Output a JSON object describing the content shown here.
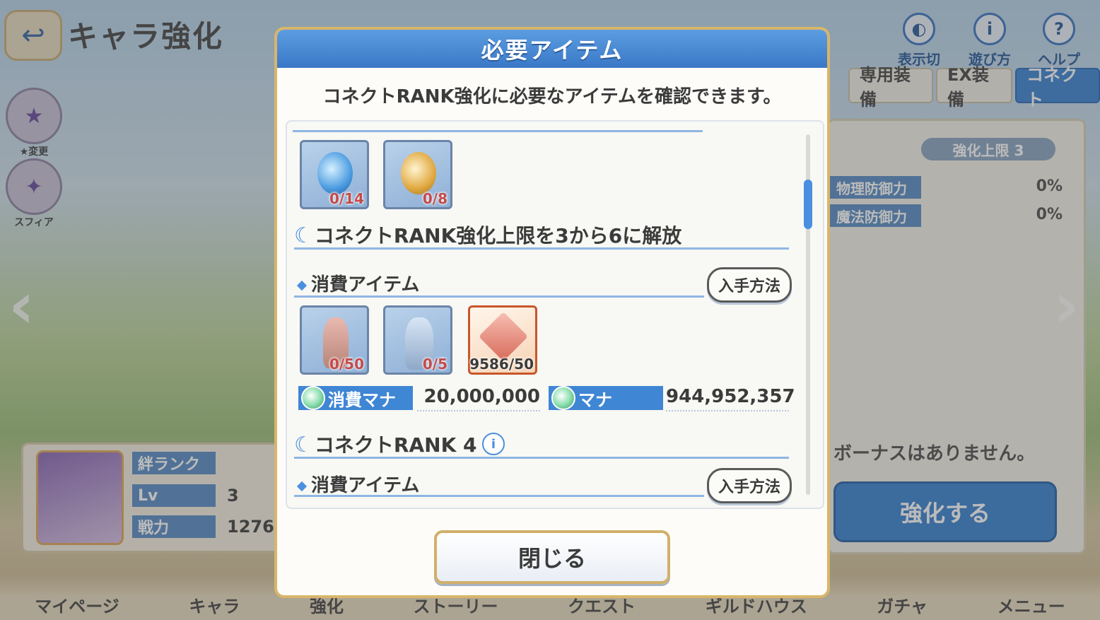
{
  "background": {
    "page_title": "キャラ強化",
    "top_icons": [
      {
        "label": "表示切替",
        "icon": "display-switch-icon"
      },
      {
        "label": "遊び方",
        "icon": "info-icon"
      },
      {
        "label": "ヘルプ",
        "icon": "help-icon"
      }
    ],
    "tabs": [
      "専用装備",
      "EX装備",
      "コネクト"
    ],
    "active_tab": "コネクト",
    "rank_pill": "強化上限 3",
    "stats": [
      {
        "label": "物理防御力",
        "value": "0%"
      },
      {
        "label": "魔法防御力",
        "value": "0%"
      }
    ],
    "bonus_text": "ボーナスはありません。",
    "enhance_button": "強化する",
    "card": {
      "rows": [
        {
          "label": "絆ランク",
          "value": ""
        },
        {
          "label": "Lv",
          "value": "3"
        },
        {
          "label": "戦力",
          "value": "1276"
        }
      ]
    },
    "side_icons": [
      {
        "label": "★変更"
      },
      {
        "label": "スフィア"
      }
    ],
    "bottom_nav": [
      "マイページ",
      "キャラ",
      "強化",
      "ストーリー",
      "クエスト",
      "ギルドハウス",
      "ガチャ",
      "メニュー"
    ]
  },
  "modal": {
    "title": "必要アイテム",
    "description": "コネクトRANK強化に必要なアイテムを確認できます。",
    "top_items": [
      {
        "count": "0/14",
        "color": "#4a9be0"
      },
      {
        "count": "0/8",
        "color": "#e0a840"
      }
    ],
    "section1": {
      "title": "コネクトRANK強化上限を3から6に解放",
      "consume_label": "消費アイテム",
      "get_method_label": "入手方法",
      "items": [
        {
          "count": "0/50",
          "kind": "statue"
        },
        {
          "count": "0/5",
          "kind": "statue"
        },
        {
          "count": "9586/50",
          "kind": "crystal"
        }
      ],
      "mana_cost_label": "消費マナ",
      "mana_cost_value": "20,000,000",
      "mana_label": "マナ",
      "mana_value": "944,952,357"
    },
    "section2": {
      "title": "コネクトRANK 4",
      "consume_label": "消費アイテム",
      "get_method_label": "入手方法"
    },
    "close_button": "閉じる"
  }
}
